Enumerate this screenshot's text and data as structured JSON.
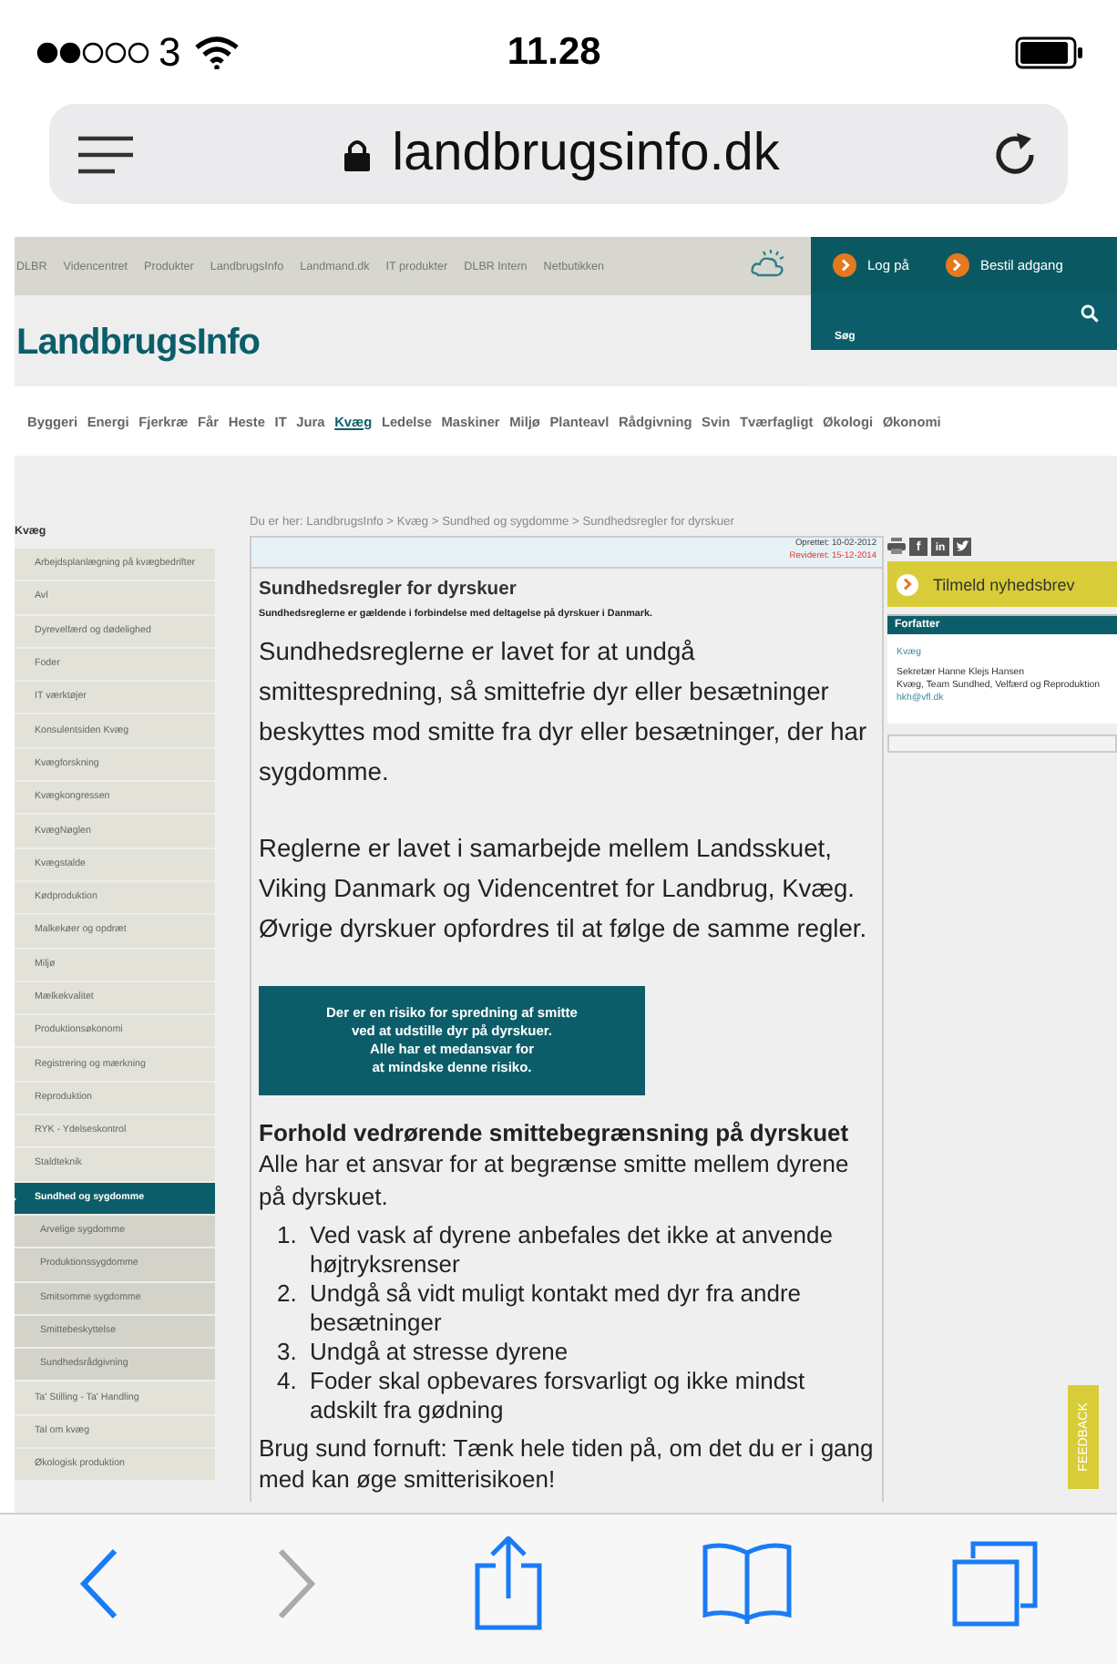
{
  "status_bar": {
    "carrier": "3",
    "time": "11.28"
  },
  "address_bar": {
    "url": "landbrugsinfo.dk"
  },
  "top_links": [
    "DLBR",
    "Videncentret",
    "Produkter",
    "LandbrugsInfo",
    "Landmand.dk",
    "IT produkter",
    "DLBR Intern",
    "Netbutikken"
  ],
  "account_links": [
    "Log på",
    "Bestil adgang"
  ],
  "search": {
    "label": "Søg"
  },
  "logo": "LandbrugsInfo",
  "categories": [
    {
      "label": "Byggeri",
      "selected": false
    },
    {
      "label": "Energi",
      "selected": false
    },
    {
      "label": "Fjerkræ",
      "selected": false
    },
    {
      "label": "Får",
      "selected": false
    },
    {
      "label": "Heste",
      "selected": false
    },
    {
      "label": "IT",
      "selected": false
    },
    {
      "label": "Jura",
      "selected": false
    },
    {
      "label": "Kvæg",
      "selected": true
    },
    {
      "label": "Ledelse",
      "selected": false
    },
    {
      "label": "Maskiner",
      "selected": false
    },
    {
      "label": "Miljø",
      "selected": false
    },
    {
      "label": "Planteavl",
      "selected": false
    },
    {
      "label": "Rådgivning",
      "selected": false
    },
    {
      "label": "Svin",
      "selected": false
    },
    {
      "label": "Tværfagligt",
      "selected": false
    },
    {
      "label": "Økologi",
      "selected": false
    },
    {
      "label": "Økonomi",
      "selected": false
    }
  ],
  "breadcrumb": "Du er her: LandbrugsInfo > Kvæg > Sundhed og sygdomme > Sundhedsregler for dyrskuer",
  "sidebar": {
    "title": "Kvæg",
    "items": [
      {
        "label": "Arbejdsplanlægning på kvægbedrifter",
        "selected": false
      },
      {
        "label": "Avl",
        "selected": false
      },
      {
        "label": "Dyrevelfærd og dødelighed",
        "selected": false
      },
      {
        "label": "Foder",
        "selected": false
      },
      {
        "label": "IT værktøjer",
        "selected": false
      },
      {
        "label": "Konsulentsiden Kvæg",
        "selected": false
      },
      {
        "label": "Kvægforskning",
        "selected": false
      },
      {
        "label": "Kvægkongressen",
        "selected": false
      },
      {
        "label": "KvægNøglen",
        "selected": false
      },
      {
        "label": "Kvægstalde",
        "selected": false
      },
      {
        "label": "Kødproduktion",
        "selected": false
      },
      {
        "label": "Malkekøer og opdræt",
        "selected": false
      },
      {
        "label": "Miljø",
        "selected": false
      },
      {
        "label": "Mælkekvalitet",
        "selected": false
      },
      {
        "label": "Produktionsøkonomi",
        "selected": false
      },
      {
        "label": "Registrering og mærkning",
        "selected": false
      },
      {
        "label": "Reproduktion",
        "selected": false
      },
      {
        "label": "RYK - Ydelseskontrol",
        "selected": false
      },
      {
        "label": "Staldteknik",
        "selected": false
      },
      {
        "label": "Sundhed og sygdomme",
        "selected": true,
        "children": [
          {
            "label": "Arvelige sygdomme",
            "selected": false
          },
          {
            "label": "Produktionssygdomme",
            "selected": false
          },
          {
            "label": "Smitsomme sygdomme",
            "selected": false
          },
          {
            "label": "Smittebeskyttelse",
            "selected": false
          },
          {
            "label": "Sundhedsrådgivning",
            "selected": false
          }
        ]
      },
      {
        "label": "Ta' Stilling - Ta' Handling",
        "selected": false
      },
      {
        "label": "Tal om kvæg",
        "selected": false
      },
      {
        "label": "Økologisk produktion",
        "selected": false
      }
    ]
  },
  "article": {
    "created": "Oprettet: 10-02-2012",
    "revised": "Revideret: 15-12-2014",
    "title": "Sundhedsregler for dyrskuer",
    "subtitle": "Sundhedsreglerne er gældende i forbindelse med deltagelse på dyrskuer i Danmark.",
    "paragraphs": [
      "Sundhedsreglerne er lavet for at undgå smittespredning, så smittefrie dyr eller besætninger beskyttes mod smitte fra dyr eller besætninger, der har sygdomme.",
      "Reglerne er lavet i samarbejde mellem Landsskuet, Viking Danmark og Videncentret for Landbrug, Kvæg. Øvrige dyrskuer opfordres til at følge de samme regler."
    ],
    "notice": [
      "Der er en risiko for spredning af smitte",
      "ved at udstille dyr på dyrskuer.",
      "Alle har et medansvar for",
      "at mindske denne risiko."
    ],
    "section_title": "Forhold vedrørende smittebegrænsning på dyrskuet",
    "section_text": "Alle har et ansvar for at begrænse smitte mellem dyrene på dyrskuet.",
    "list": [
      {
        "number": "1.",
        "text": "Ved vask af dyrene anbefales det ikke at anvende højtryksrenser"
      },
      {
        "number": "2.",
        "text": "Undgå så vidt muligt kontakt med dyr fra andre besætninger"
      },
      {
        "number": "3.",
        "text": "Undgå at stresse dyrene"
      },
      {
        "number": "4.",
        "text": "Foder skal opbevares forsvarligt og ikke mindst adskilt fra gødning"
      }
    ],
    "closing": "Brug sund fornuft: Tænk hele tiden på, om det du er i gang med kan øge smitterisikoen!"
  },
  "share": [
    {
      "kind": "print"
    },
    {
      "kind": "facebook",
      "label": "f"
    },
    {
      "kind": "linkedin",
      "label": "in"
    },
    {
      "kind": "twitter"
    }
  ],
  "newsletter": "Tilmeld nyhedsbrev",
  "author": {
    "heading": "Forfatter",
    "category": "Kvæg",
    "name": "Sekretær Hanne Klejs Hansen",
    "unit": "Kvæg, Team Sundhed, Velfærd og Reproduktion",
    "email": "hkh@vfl.dk"
  },
  "feedback": "FEEDBACK",
  "toolbar": [
    {
      "kind": "back",
      "disabled": false
    },
    {
      "kind": "forward",
      "disabled": true
    },
    {
      "kind": "share",
      "disabled": false
    },
    {
      "kind": "bookmarks",
      "disabled": false
    },
    {
      "kind": "tabs",
      "disabled": false
    }
  ]
}
